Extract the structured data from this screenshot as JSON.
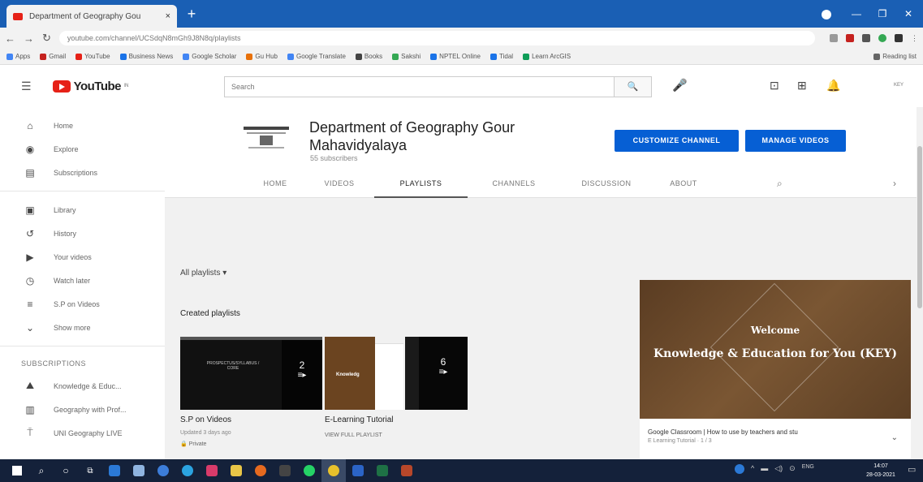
{
  "browser": {
    "tab_title": "Department of Geography Gou",
    "tab_close": "×",
    "new_tab": "+",
    "url": "youtube.com/channel/UCSdqN8mGh9J8N8q/playlists",
    "bookmarks": [
      {
        "label": "Apps",
        "color": "#4285f4"
      },
      {
        "label": "Gmail",
        "color": "#c5221f"
      },
      {
        "label": "YouTube",
        "color": "#e62117"
      },
      {
        "label": "Business News",
        "color": "#1a73e8"
      },
      {
        "label": "Google Scholar",
        "color": "#4285f4"
      },
      {
        "label": "Gu Hub",
        "color": "#e8710a"
      },
      {
        "label": "Google Translate",
        "color": "#4285f4"
      },
      {
        "label": "Books",
        "color": "#444444"
      },
      {
        "label": "Sakshi",
        "color": "#34a853"
      },
      {
        "label": "NPTEL Online",
        "color": "#1a73e8"
      },
      {
        "label": "Tidal",
        "color": "#1a73e8"
      },
      {
        "label": "Learn ArcGIS",
        "color": "#0f9d58"
      },
      {
        "label": "Reading list",
        "color": "#666666"
      }
    ]
  },
  "masthead": {
    "logo_text": "YouTube",
    "logo_sup": "IN",
    "search_placeholder": "Search",
    "search_btn": "🔍",
    "mic": "🎤",
    "avatar_text": "KEY"
  },
  "sidebar": {
    "main": [
      {
        "icon": "⌂",
        "label": "Home",
        "name": "home"
      },
      {
        "icon": "◉",
        "label": "Explore",
        "name": "explore"
      },
      {
        "icon": "▤",
        "label": "Subscriptions",
        "name": "subscriptions"
      }
    ],
    "library": [
      {
        "icon": "▣",
        "label": "Library",
        "name": "library"
      },
      {
        "icon": "↺",
        "label": "History",
        "name": "history"
      },
      {
        "icon": "▶",
        "label": "Your videos",
        "name": "your-videos"
      },
      {
        "icon": "◷",
        "label": "Watch later",
        "name": "watch-later"
      },
      {
        "icon": "≡",
        "label": "S.P on Videos",
        "name": "sp-on-videos"
      },
      {
        "icon": "⌄",
        "label": "Show more",
        "name": "show-more"
      }
    ],
    "subs_heading": "SUBSCRIPTIONS",
    "subs": [
      {
        "label": "Knowledge & Educ...",
        "name": "sub-knowledge"
      },
      {
        "label": "Geography with Prof...",
        "name": "sub-geography"
      },
      {
        "label": "UNI Geography LIVE",
        "name": "sub-uni-geography"
      }
    ]
  },
  "channel": {
    "name": "Department of Geography Gour Mahavidyalaya",
    "subscribers": "55 subscribers",
    "customize_btn": "CUSTOMIZE CHANNEL",
    "manage_btn": "MANAGE VIDEOS",
    "tabs": [
      "HOME",
      "VIDEOS",
      "PLAYLISTS",
      "CHANNELS",
      "DISCUSSION",
      "ABOUT"
    ],
    "active_tab": "PLAYLISTS"
  },
  "content": {
    "all_playlists": "All playlists ▾",
    "created_heading": "Created playlists",
    "playlists": [
      {
        "title": "S.P on Videos",
        "sub1": "Updated 3 days ago",
        "sub2": "🔒 Private",
        "count": "2"
      },
      {
        "title": "E-Learning Tutorial",
        "sub1": "VIEW FULL PLAYLIST",
        "sub2": "",
        "count": ""
      },
      {
        "title": "",
        "sub1": "",
        "sub2": "",
        "count": "6"
      }
    ],
    "thumb1_text": "PROSPECTUS/SYLLABUS / CORE",
    "thumb2_text": "Knowledg",
    "featured": {
      "welcome": "Welcome",
      "headline": "Knowledge & Education for You (KEY)",
      "video_title": "Google Classroom | How to use by teachers and stu",
      "channel": "E Learning Tutorial · 1 / 3"
    }
  },
  "taskbar": {
    "clock_time": "14:07",
    "clock_date": "28-03-2021",
    "lang": "ENG"
  }
}
